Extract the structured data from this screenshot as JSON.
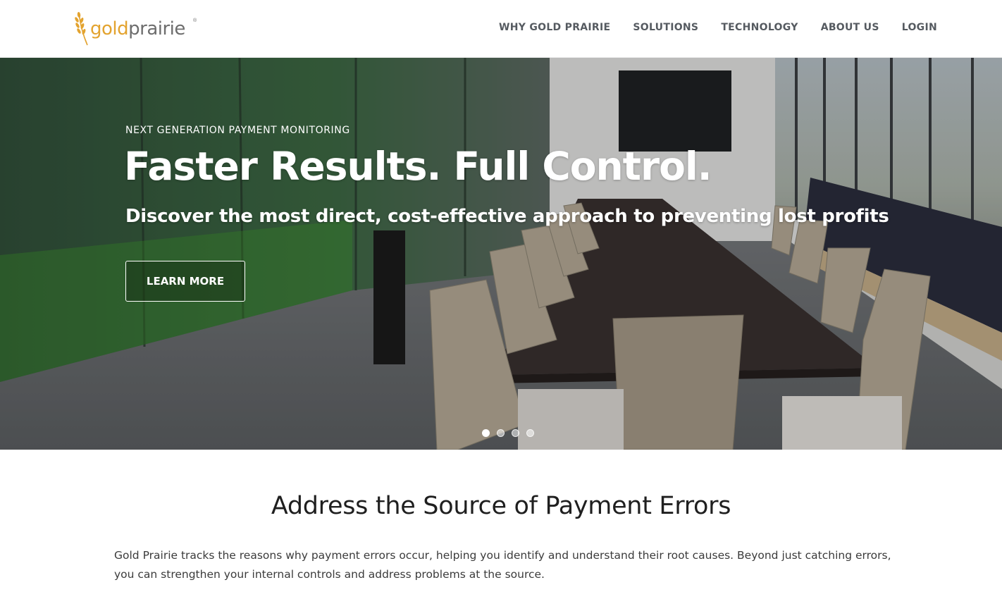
{
  "brand": {
    "logo_part1": "gold",
    "logo_part2": "prairie",
    "trademark": "®",
    "accent_color": "#e3a32f"
  },
  "nav": {
    "items": [
      {
        "label": "WHY GOLD PRAIRIE"
      },
      {
        "label": "SOLUTIONS"
      },
      {
        "label": "TECHNOLOGY"
      },
      {
        "label": "ABOUT US"
      },
      {
        "label": "LOGIN"
      }
    ]
  },
  "hero": {
    "eyebrow": "NEXT GENERATION PAYMENT MONITORING",
    "title": "Faster Results. Full Control.",
    "subtitle": "Discover the most direct, cost-effective approach to preventing lost profits",
    "button_label": "LEARN MORE",
    "slides_total": 4,
    "active_slide": 1
  },
  "section": {
    "title": "Address the Source of Payment Errors",
    "body": "Gold Prairie tracks the reasons why payment errors occur, helping you identify and understand their root causes. Beyond just catching errors, you can strengthen your internal controls and address problems at the source."
  }
}
